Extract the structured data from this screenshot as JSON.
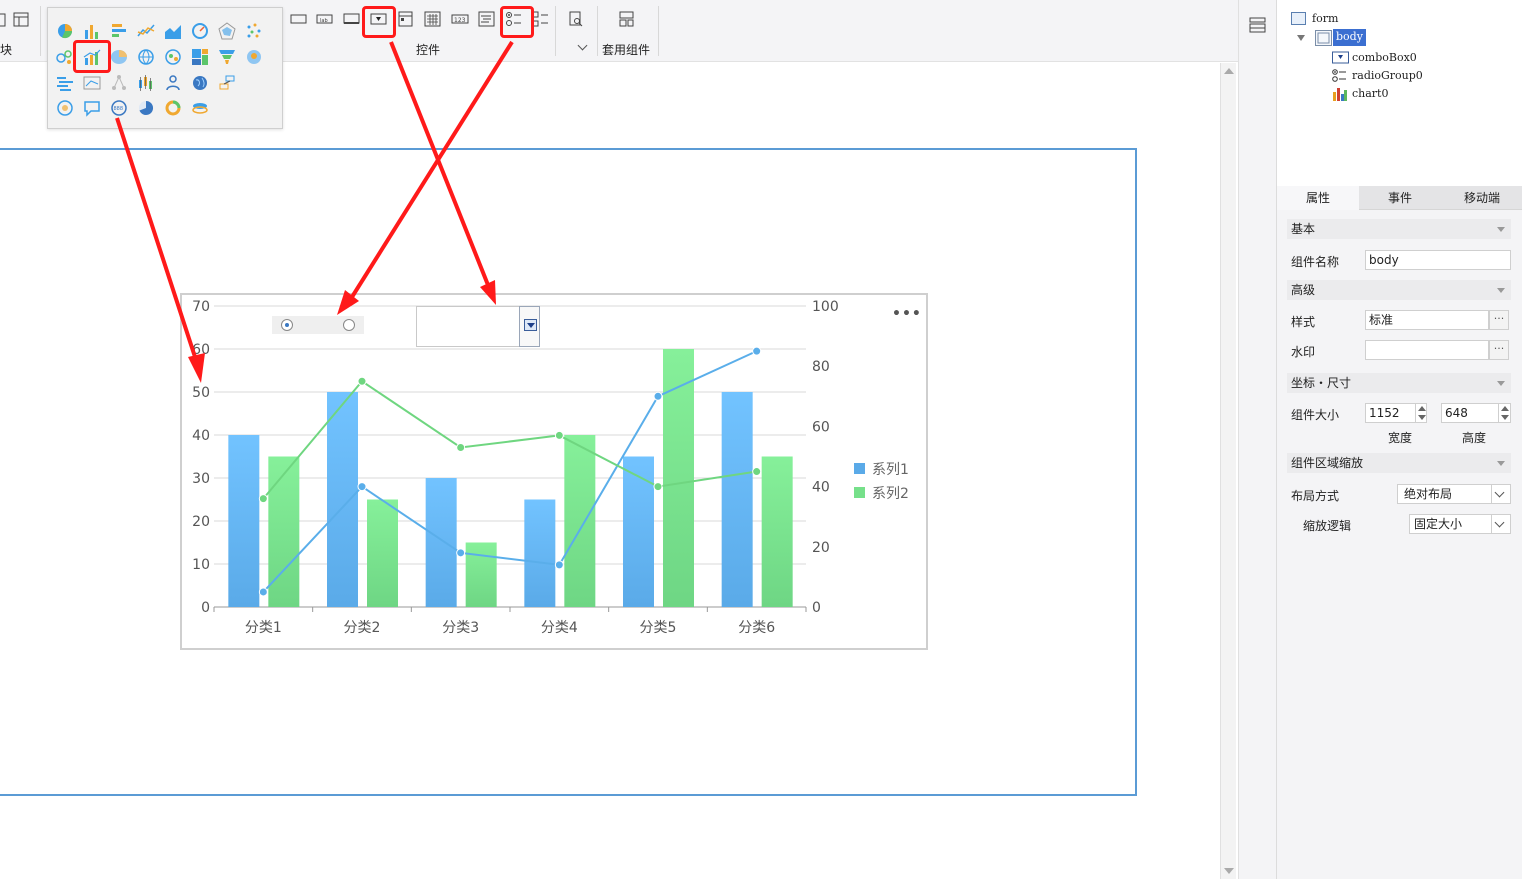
{
  "toolbar": {
    "left_partial_label": "块",
    "controls_label": "控件",
    "template_label": "套用组件"
  },
  "canvas": {
    "radio_group": {
      "selected_index": 0
    },
    "combo": {
      "value": ""
    }
  },
  "chart_data": {
    "type": "bar",
    "categories": [
      "分类1",
      "分类2",
      "分类3",
      "分类4",
      "分类5",
      "分类6"
    ],
    "series": [
      {
        "name": "系列1",
        "type": "bar",
        "axis": "left",
        "values": [
          40,
          50,
          30,
          25,
          35,
          50
        ],
        "color": "#66b5f5"
      },
      {
        "name": "系列2",
        "type": "bar",
        "axis": "left",
        "values": [
          35,
          25,
          15,
          40,
          60,
          35
        ],
        "color": "#7ee08f"
      },
      {
        "name": "系列1",
        "type": "line",
        "axis": "right",
        "values": [
          5,
          40,
          18,
          14,
          70,
          85
        ],
        "color": "#5aaeea"
      },
      {
        "name": "系列2",
        "type": "line",
        "axis": "right",
        "values": [
          36,
          75,
          53,
          57,
          40,
          45
        ],
        "color": "#6fd680"
      }
    ],
    "y_left": {
      "min": 0,
      "max": 70,
      "ticks": [
        0,
        10,
        20,
        30,
        40,
        50,
        60,
        70
      ]
    },
    "y_right": {
      "min": 0,
      "max": 100,
      "ticks": [
        0,
        20,
        40,
        60,
        80,
        100
      ]
    },
    "legend": {
      "position": "right",
      "items": [
        "系列1",
        "系列2"
      ]
    },
    "grid": true,
    "more_label": "•••"
  },
  "tree": {
    "items": [
      {
        "label": "form",
        "level": 0
      },
      {
        "label": "body",
        "level": 1,
        "selected": true
      },
      {
        "label": "comboBox0",
        "level": 2
      },
      {
        "label": "radioGroup0",
        "level": 2
      },
      {
        "label": "chart0",
        "level": 2
      }
    ]
  },
  "panel": {
    "tabs": [
      "属性",
      "事件",
      "移动端"
    ],
    "sections": {
      "basic": "基本",
      "advanced": "高级",
      "coords": "坐标・尺寸",
      "scale": "组件区域缩放"
    },
    "fields": {
      "name_label": "组件名称",
      "name_value": "body",
      "style_label": "样式",
      "style_value": "标准",
      "watermark_label": "水印",
      "watermark_value": "",
      "size_label": "组件大小",
      "width_value": "1152",
      "height_value": "648",
      "width_caption": "宽度",
      "height_caption": "高度",
      "layout_label": "布局方式",
      "layout_value": "绝对布局",
      "scale_label": "缩放逻辑",
      "scale_value": "固定大小"
    },
    "dots": "···"
  },
  "colors": {
    "highlight": "#ff1a1a",
    "frame": "#5b9bd5",
    "selected_tree": "#3b6fd1"
  }
}
